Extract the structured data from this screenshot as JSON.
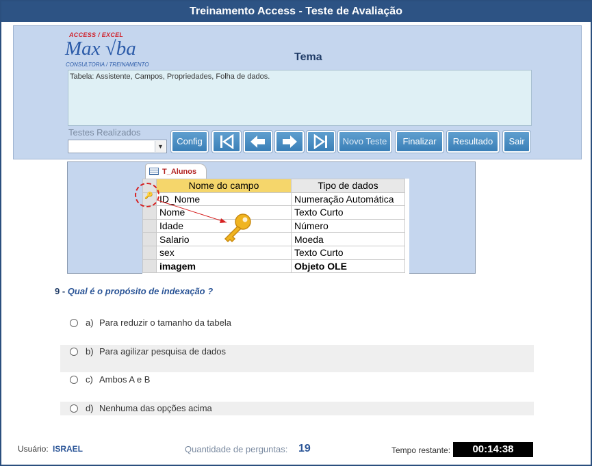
{
  "window": {
    "title": "Treinamento Access - Teste de Avaliação"
  },
  "logo": {
    "top": "ACCESS / EXCEL",
    "main": "Max √ba",
    "sub": "CONSULTORIA / TREINAMENTO"
  },
  "tema": {
    "label": "Tema",
    "text": "Tabela: Assistente, Campos, Propriedades, Folha de dados."
  },
  "testes": {
    "label": "Testes Realizados",
    "value": ""
  },
  "toolbar": {
    "config": "Config",
    "first_icon": "first-record-icon",
    "prev_icon": "previous-arrow-icon",
    "next_icon": "next-arrow-icon",
    "last_icon": "last-record-icon",
    "novo_teste": "Novo Teste",
    "finalizar": "Finalizar",
    "resultado": "Resultado",
    "sair": "Sair"
  },
  "table_image": {
    "tab": "T_Alunos",
    "headers": [
      "Nome do campo",
      "Tipo de dados"
    ],
    "rows": [
      {
        "nome": "ID_Nome",
        "tipo": "Numeração Automática"
      },
      {
        "nome": "Nome",
        "tipo": "Texto Curto"
      },
      {
        "nome": "Idade",
        "tipo": "Número"
      },
      {
        "nome": "Salario",
        "tipo": "Moeda"
      },
      {
        "nome": "sex",
        "tipo": "Texto Curto"
      },
      {
        "nome": "imagem",
        "tipo": "Objeto OLE"
      }
    ]
  },
  "question": {
    "number": "9 -",
    "text": "Qual é o propósito de indexação ?"
  },
  "options": [
    {
      "letter": "a)",
      "text": "Para reduzir o tamanho da tabela"
    },
    {
      "letter": "b)",
      "text": "Para agilizar pesquisa de dados"
    },
    {
      "letter": "c)",
      "text": "Ambos A e B"
    },
    {
      "letter": "d)",
      "text": "Nenhuma das opções acima"
    }
  ],
  "footer": {
    "user_label": "Usuário:",
    "user": "ISRAEL",
    "qtd_label": "Quantidade de perguntas:",
    "qtd": "19",
    "tempo_label": "Tempo restante:",
    "tempo": "00:14:38"
  },
  "colors": {
    "titlebar": "#2d5384",
    "panel": "#c5d6ee",
    "button": "#4a8ec4",
    "accent": "#2b5597"
  }
}
